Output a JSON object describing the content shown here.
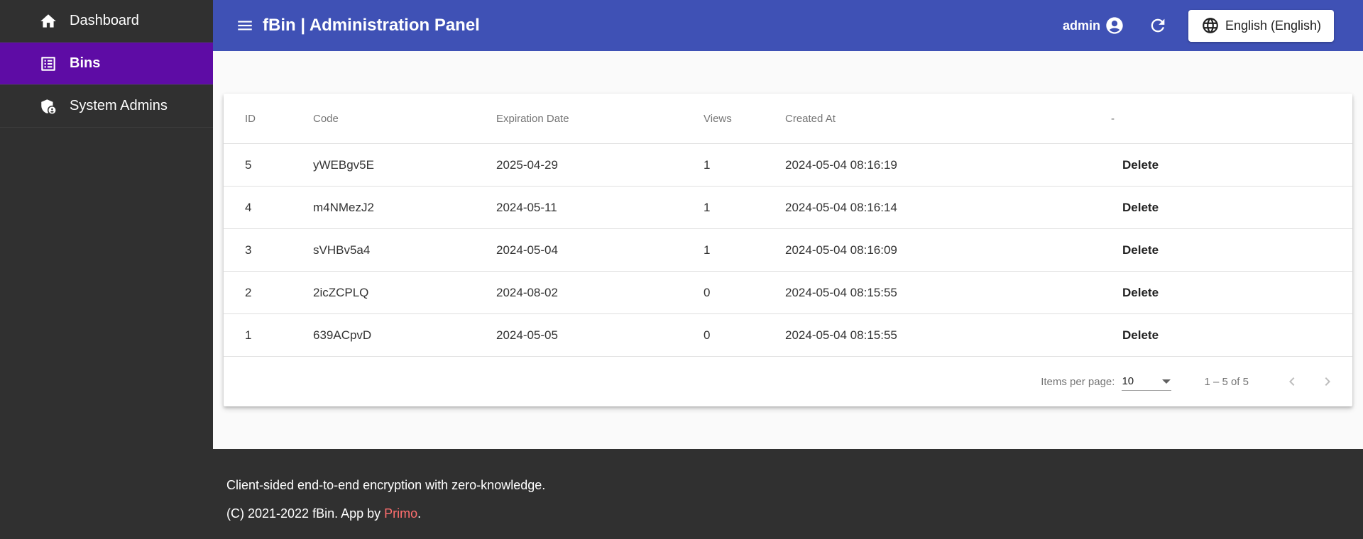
{
  "sidebar": {
    "items": [
      {
        "label": "Dashboard",
        "icon": "home-icon"
      },
      {
        "label": "Bins",
        "icon": "list-icon"
      },
      {
        "label": "System Admins",
        "icon": "admin-shield-icon"
      }
    ]
  },
  "topbar": {
    "title": "fBin | Administration Panel",
    "user": "admin",
    "language": "English (English)"
  },
  "table": {
    "headers": {
      "id": "ID",
      "code": "Code",
      "expiration": "Expiration Date",
      "views": "Views",
      "created": "Created At",
      "actions": "-"
    },
    "rows": [
      {
        "id": "5",
        "code": "yWEBgv5E",
        "expiration": "2025-04-29",
        "views": "1",
        "created": "2024-05-04 08:16:19",
        "action": "Delete"
      },
      {
        "id": "4",
        "code": "m4NMezJ2",
        "expiration": "2024-05-11",
        "views": "1",
        "created": "2024-05-04 08:16:14",
        "action": "Delete"
      },
      {
        "id": "3",
        "code": "sVHBv5a4",
        "expiration": "2024-05-04",
        "views": "1",
        "created": "2024-05-04 08:16:09",
        "action": "Delete"
      },
      {
        "id": "2",
        "code": "2icZCPLQ",
        "expiration": "2024-08-02",
        "views": "0",
        "created": "2024-05-04 08:15:55",
        "action": "Delete"
      },
      {
        "id": "1",
        "code": "639ACpvD",
        "expiration": "2024-05-05",
        "views": "0",
        "created": "2024-05-04 08:15:55",
        "action": "Delete"
      }
    ]
  },
  "paginator": {
    "label": "Items per page:",
    "page_size": "10",
    "range": "1 – 5 of 5"
  },
  "footer": {
    "line1": "Client-sided end-to-end encryption with zero-knowledge.",
    "line2_prefix": "(C) 2021-2022 fBin. App by ",
    "line2_link": "Primo",
    "line2_suffix": "."
  },
  "colors": {
    "topbar": "#3f51b5",
    "sidebar": "#303030",
    "sidebar_active": "#5e0ca5",
    "footer_link": "#ff6e6e"
  }
}
